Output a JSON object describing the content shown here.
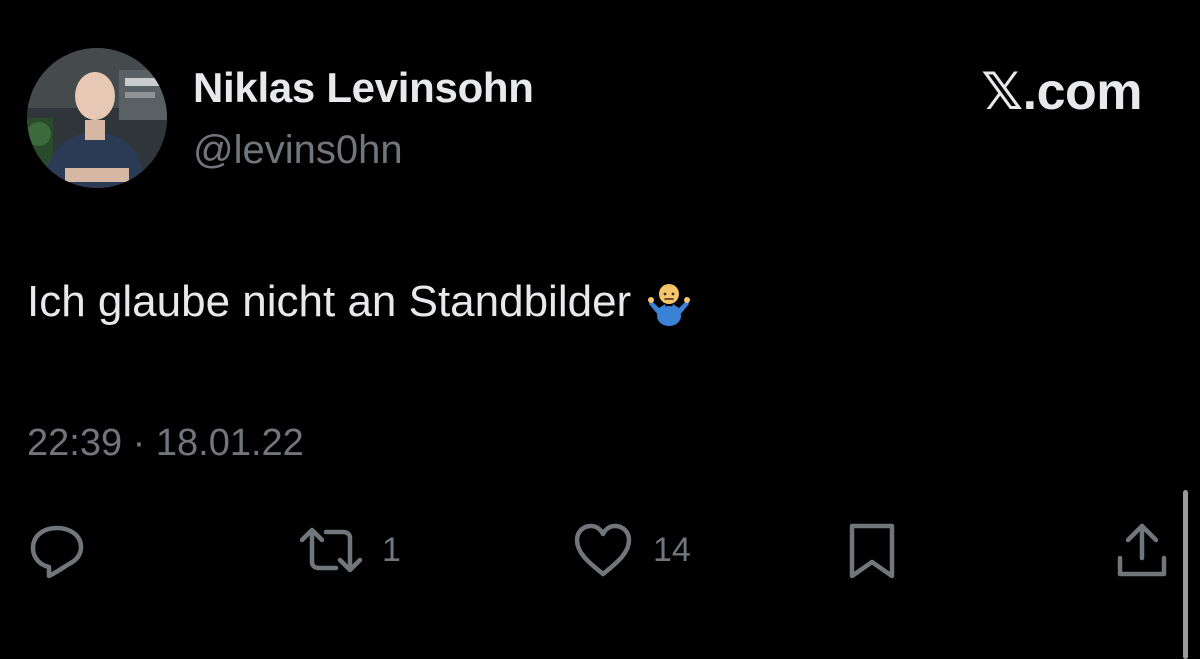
{
  "author": {
    "display_name": "Niklas Levinsohn",
    "handle": "@levins0hn"
  },
  "brand": {
    "label": "𝕏.com"
  },
  "tweet": {
    "text": "Ich glaube nicht an Standbilder",
    "emoji": "man-shrugging-emoji",
    "timestamp": "22:39 · 18.01.22"
  },
  "actions": {
    "reply": {
      "icon": "reply-bubble-icon",
      "count": ""
    },
    "retweet": {
      "icon": "retweet-icon",
      "count": "1"
    },
    "like": {
      "icon": "heart-icon",
      "count": "14"
    },
    "bookmark": {
      "icon": "bookmark-icon"
    },
    "share": {
      "icon": "share-icon"
    }
  },
  "colors": {
    "background": "#000000",
    "text_primary": "#e7e9ea",
    "text_secondary": "#71767b"
  }
}
